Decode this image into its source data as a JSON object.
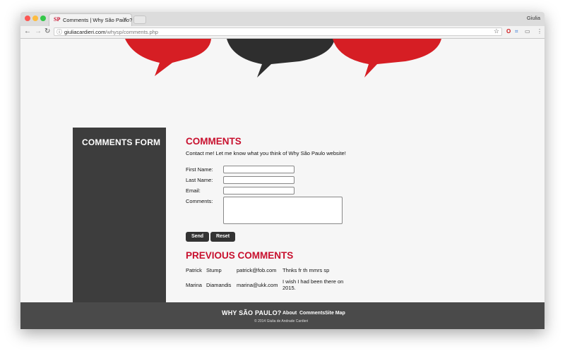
{
  "browser": {
    "tab_title": "Comments | Why São Paulo?",
    "tab_icon": "SP",
    "user_name": "Giulia",
    "url_host": "giuliacardieri.com",
    "url_path": "/whysp/comments.php"
  },
  "sidebar": {
    "title": "COMMENTS FORM"
  },
  "form": {
    "heading": "COMMENTS",
    "intro": "Contact me! Let me know what you think of Why São Paulo website!",
    "first_name_label": "First Name:",
    "last_name_label": "Last Name:",
    "email_label": "Email:",
    "comments_label": "Comments:",
    "send_label": "Send",
    "reset_label": "Reset"
  },
  "previous": {
    "heading": "PREVIOUS COMMENTS",
    "rows": [
      {
        "first": "Patrick",
        "last": "Stump",
        "email": "patrick@fob.com",
        "comment": "Thnks fr th mmrs sp"
      },
      {
        "first": "Marina",
        "last": "Diamandis",
        "email": "marina@ukk.com",
        "comment_line1": "I wish I had been there on",
        "comment_line2": "2015."
      }
    ]
  },
  "footer": {
    "title": "WHY SÃO PAULO?",
    "links": [
      "About",
      "Comments",
      "Site Map"
    ],
    "copyright": "© 2014 Giulia de Andrade Cardieri"
  },
  "colors": {
    "brand_red": "#c8102e",
    "dark": "#3d3d3d",
    "footer": "#4a4a4a"
  }
}
